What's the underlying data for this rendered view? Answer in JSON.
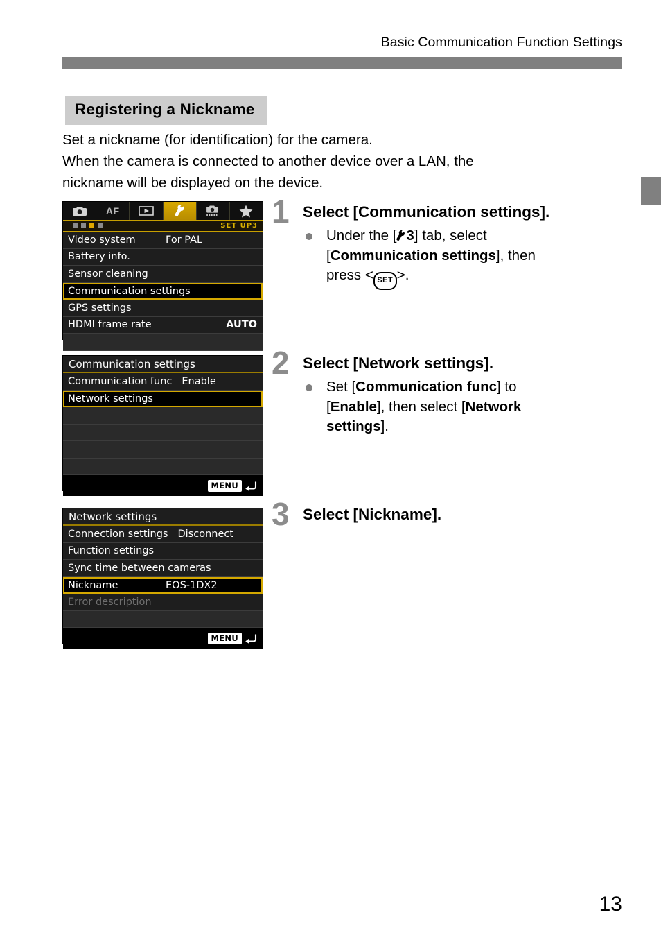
{
  "header": {
    "running_head": "Basic Communication Function Settings"
  },
  "section": {
    "heading": "Registering a Nickname",
    "intro_line1": "Set a nickname (for identification) for the camera.",
    "intro_line2": "When the camera is connected to another device over a LAN, the",
    "intro_line3": "nickname will be displayed on the device."
  },
  "steps": [
    {
      "number": "1",
      "title": "Select [Communication settings].",
      "body_1": "Under the [",
      "body_tab": "3",
      "body_2": "] tab, select",
      "body_3": "Communication settings",
      "body_4": "], then",
      "body_5": "press <",
      "set_label": "SET",
      "body_6": ">."
    },
    {
      "number": "2",
      "title": "Select [Network settings].",
      "body_1": "Set [",
      "body_2": "Communication func",
      "body_3": "] to",
      "body_4": "Enable",
      "body_5": "], then select [",
      "body_6": "Network",
      "body_7": "settings",
      "body_8": "]."
    },
    {
      "number": "3",
      "title": "Select [Nickname]."
    }
  ],
  "screen1": {
    "tabs": [
      {
        "name": "shooting-tab",
        "icon": "camera-icon",
        "label": ""
      },
      {
        "name": "af-tab",
        "icon": "af-text",
        "label": "AF"
      },
      {
        "name": "playback-tab",
        "icon": "play-icon",
        "label": ""
      },
      {
        "name": "setup-tab",
        "icon": "wrench-icon",
        "label": ""
      },
      {
        "name": "custom-functions-tab",
        "icon": "camera-cfn-icon",
        "label": ""
      },
      {
        "name": "my-menu-tab",
        "icon": "star-icon",
        "label": ""
      }
    ],
    "active_tab_index": 3,
    "page_dots": 4,
    "active_dot_index": 2,
    "setup_label": "SET UP3",
    "rows": [
      {
        "label": "Video system",
        "value": "For PAL",
        "selected": false,
        "value_pos": "center"
      },
      {
        "label": "Battery info.",
        "value": "",
        "selected": false,
        "value_pos": "none"
      },
      {
        "label": "Sensor cleaning",
        "value": "",
        "selected": false,
        "value_pos": "none"
      },
      {
        "label": "Communication settings",
        "value": "",
        "selected": true,
        "value_pos": "none"
      },
      {
        "label": "GPS settings",
        "value": "",
        "selected": false,
        "value_pos": "none"
      },
      {
        "label": "HDMI frame rate",
        "value": "AUTO",
        "selected": false,
        "value_pos": "right"
      }
    ]
  },
  "screen2": {
    "title": "Communication settings",
    "rows": [
      {
        "label": "Communication func",
        "value": "Enable",
        "selected": false,
        "value_pos": "inline"
      },
      {
        "label": "Network settings",
        "value": "",
        "selected": true,
        "value_pos": "none"
      },
      {
        "label": "",
        "value": "",
        "selected": false,
        "value_pos": "none"
      },
      {
        "label": "",
        "value": "",
        "selected": false,
        "value_pos": "none"
      },
      {
        "label": "",
        "value": "",
        "selected": false,
        "value_pos": "none"
      },
      {
        "label": "",
        "value": "",
        "selected": false,
        "value_pos": "none"
      }
    ],
    "menu_chip": "MENU"
  },
  "screen3": {
    "title": "Network settings",
    "rows": [
      {
        "label": "Connection settings",
        "value": "Disconnect",
        "selected": false,
        "value_pos": "inline"
      },
      {
        "label": "Function settings",
        "value": "",
        "selected": false,
        "value_pos": "none"
      },
      {
        "label": "Sync time between cameras",
        "value": "",
        "selected": false,
        "value_pos": "none"
      },
      {
        "label": "Nickname",
        "value": "EOS-1DX2",
        "selected": true,
        "value_pos": "center"
      },
      {
        "label": "Error description",
        "value": "",
        "selected": false,
        "value_pos": "none",
        "dim": true
      },
      {
        "label": "",
        "value": "",
        "selected": false,
        "value_pos": "none"
      }
    ],
    "menu_chip": "MENU"
  },
  "footer": {
    "page_number": "13"
  },
  "colors": {
    "accent_gold": "#d4a800",
    "header_rule": "#808080",
    "heading_bg": "#cccccc",
    "step_number": "#8c8c8c",
    "screen_bg": "#1e1e1e"
  }
}
